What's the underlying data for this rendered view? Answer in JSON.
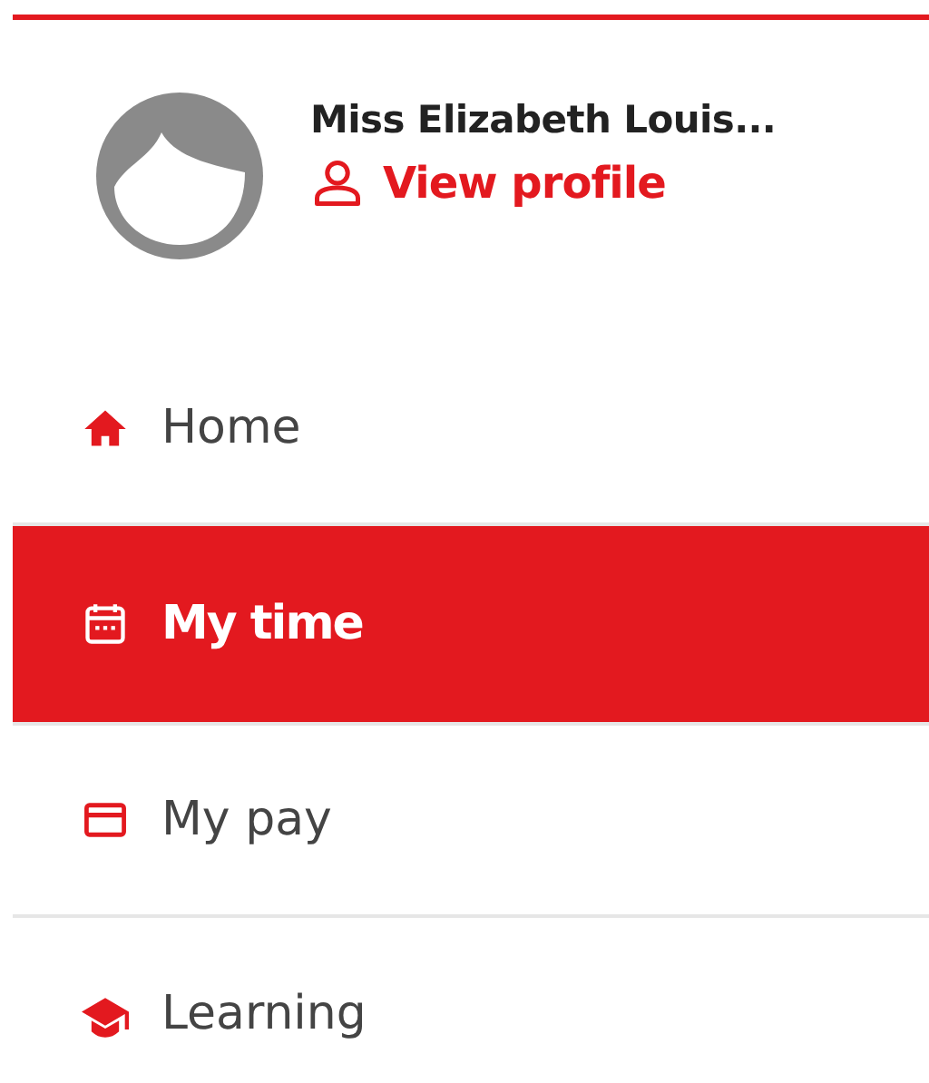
{
  "profile": {
    "name": "Miss Elizabeth Louis...",
    "link": "View profile"
  },
  "nav": [
    {
      "label": "Home",
      "kind": "home",
      "selected": false
    },
    {
      "label": "My time",
      "kind": "calendar",
      "selected": true
    },
    {
      "label": "My pay",
      "kind": "card",
      "selected": false
    },
    {
      "label": "Learning",
      "kind": "cap",
      "selected": false
    }
  ]
}
